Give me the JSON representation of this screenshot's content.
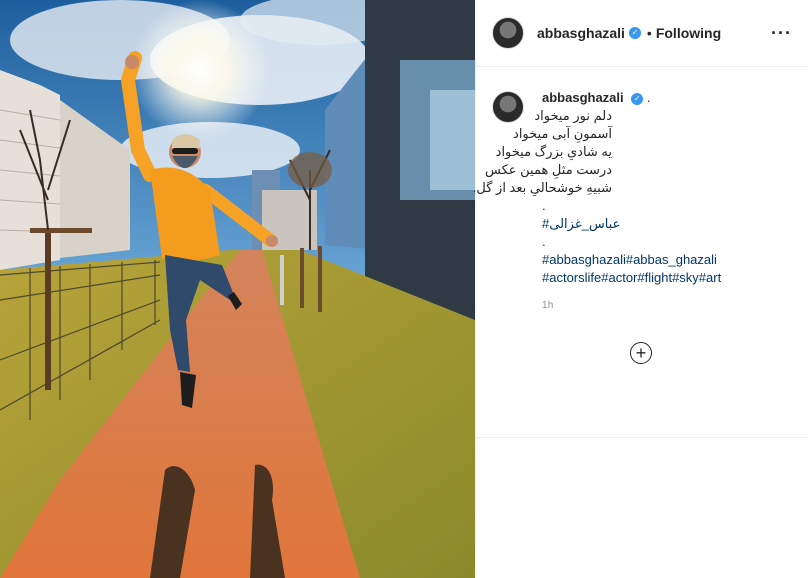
{
  "post": {
    "username": "abbasghazali",
    "follow_state": "Following",
    "more_icon": "more-horizontal-icon",
    "caption": {
      "trail": ".",
      "lines": [
        "دلم نور میخواد",
        "آسمونِ آبی میخواد",
        "یه شادیِ بزرگ میخواد",
        "درست مثلِ همین عکس",
        "شبیهِ خوشحالیِ بعد از گل."
      ],
      "dot1": ".",
      "hashtag_fa": "#عباس_غزالی",
      "dot2": ".",
      "hashtags_en_1": "#abbasghazali#abbas_ghazali",
      "hashtags_en_2": "#actorslife#actor#flight#sky#art"
    },
    "time": "1h",
    "load_more_icon": "plus-circle-icon"
  },
  "colors": {
    "verified": "#3897f0",
    "hashtag": "#00376b",
    "muted": "#8e8e8e"
  }
}
